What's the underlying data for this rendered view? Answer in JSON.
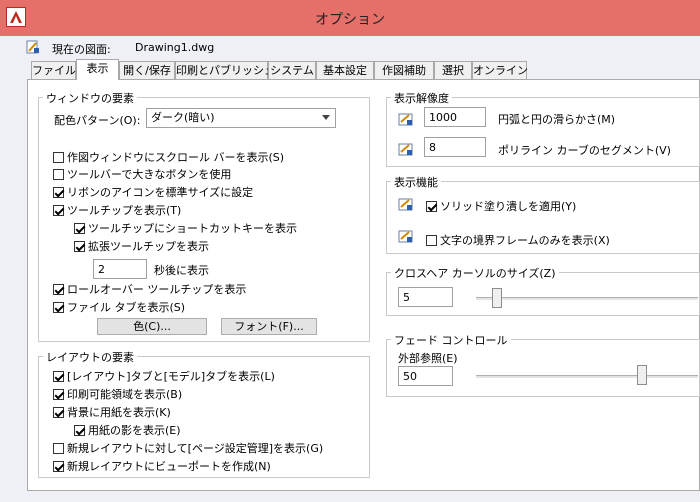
{
  "window": {
    "title": "オプション"
  },
  "drawing": {
    "label": "現在の図面:",
    "name": "Drawing1.dwg"
  },
  "tabs": [
    {
      "label": "ファイル"
    },
    {
      "label": "表示"
    },
    {
      "label": "開く/保存"
    },
    {
      "label": "印刷とパブリッシュ"
    },
    {
      "label": "システム"
    },
    {
      "label": "基本設定"
    },
    {
      "label": "作図補助"
    },
    {
      "label": "選択"
    },
    {
      "label": "オンライン"
    }
  ],
  "active_tab": "表示",
  "window_elements": {
    "title": "ウィンドウの要素",
    "color_scheme_label": "配色パターン(O):",
    "color_scheme_value": "ダーク(暗い)",
    "options": [
      {
        "label": "作図ウィンドウにスクロール バーを表示(S)",
        "checked": false
      },
      {
        "label": "ツールバーで大きなボタンを使用",
        "checked": false
      },
      {
        "label": "リボンのアイコンを標準サイズに設定",
        "checked": true
      },
      {
        "label": "ツールチップを表示(T)",
        "checked": true
      },
      {
        "label": "ツールチップにショートカットキーを表示",
        "checked": true
      },
      {
        "label": "拡張ツールチップを表示",
        "checked": true
      }
    ],
    "delay_value": "2",
    "delay_label": "秒後に表示",
    "options2": [
      {
        "label": "ロールオーバー ツールチップを表示",
        "checked": true
      },
      {
        "label": "ファイル タブを表示(S)",
        "checked": true
      }
    ],
    "colors_button": "色(C)...",
    "fonts_button": "フォント(F)..."
  },
  "layout_elements": {
    "title": "レイアウトの要素",
    "options": [
      {
        "label": "[レイアウト]タブと[モデル]タブを表示(L)",
        "checked": true
      },
      {
        "label": "印刷可能領域を表示(B)",
        "checked": true
      },
      {
        "label": "背景に用紙を表示(K)",
        "checked": true
      },
      {
        "label": "用紙の影を表示(E)",
        "checked": true
      },
      {
        "label": "新規レイアウトに対して[ページ設定管理]を表示(G)",
        "checked": false
      },
      {
        "label": "新規レイアウトにビューポートを作成(N)",
        "checked": true
      }
    ]
  },
  "display_resolution": {
    "title": "表示解像度",
    "arc_value": "1000",
    "arc_label": "円弧と円の滑らかさ(M)",
    "polyline_value": "8",
    "polyline_label": "ポリライン カーブのセグメント(V)"
  },
  "display_performance": {
    "title": "表示機能",
    "solid_fill_label": "ソリッド塗り潰しを適用(Y)",
    "solid_fill_checked": true,
    "text_frame_label": "文字の境界フレームのみを表示(X)",
    "text_frame_checked": false
  },
  "crosshair": {
    "title": "クロスヘア カーソルのサイズ(Z)",
    "value": "5",
    "level_percent": 5
  },
  "fade_control": {
    "title": "フェード コントロール",
    "xref_label": "外部参照(E)",
    "xref_value": "50",
    "level_percent": 50
  },
  "colors": {
    "title_bar": "#e56f69",
    "window_bg": "#eef0f5",
    "panel_bg": "#ffffff"
  },
  "icons": {
    "app": "autocad-logo-icon",
    "drawing": "drawing-file-icon"
  }
}
